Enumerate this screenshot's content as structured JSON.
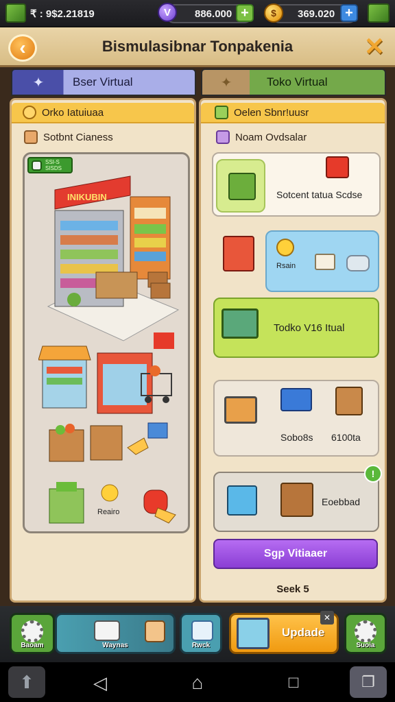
{
  "status_bar": {
    "cash_value": "₹ : 9$2.21819",
    "gems_value": "886.000",
    "coins_value": "369.020",
    "gem_symbol": "V",
    "coin_symbol": "$"
  },
  "header": {
    "title": "Bismulasibnar Tonpakenia"
  },
  "tabs": [
    {
      "label": "Bser Virtual"
    },
    {
      "label": "Toko Virtual"
    }
  ],
  "left_panel": {
    "head_label": "Orko Iatuiuaa",
    "sub_label": "Sotbnt Cianess",
    "badge_line1": "SSI-S",
    "badge_line2": "SISDS",
    "shelf_banner": "INIKUBIN",
    "item_label": "Reairo"
  },
  "right_panel": {
    "head_label": "Oelen Sbnr!uusr",
    "sub_label": "Noam Ovdsalar",
    "card1_text": "Sotcent tatua Scdse",
    "card2_text": "Rsain",
    "card3_text": "Todko V16 Itual",
    "card4_text1": "Sobo8s",
    "card4_text2": "6100ta",
    "card5_text": "Eoebbad",
    "purple_button": "Sgp Vitiaaer",
    "footer_text": "Seek 5"
  },
  "toolbar": {
    "btn1_label": "Baoam",
    "btn2_label": "Waynas",
    "btn3_label": "Rwck",
    "update_label": "Updade",
    "btn5_label": "Suoia"
  },
  "colors": {
    "accent_orange": "#e07a10",
    "panel_bg": "#f1e3c8",
    "tab_blue": "#4a4fa8",
    "tab_green": "#74a94a",
    "button_purple": "#8a3ed4",
    "toolbar_green": "#5aa53a"
  }
}
